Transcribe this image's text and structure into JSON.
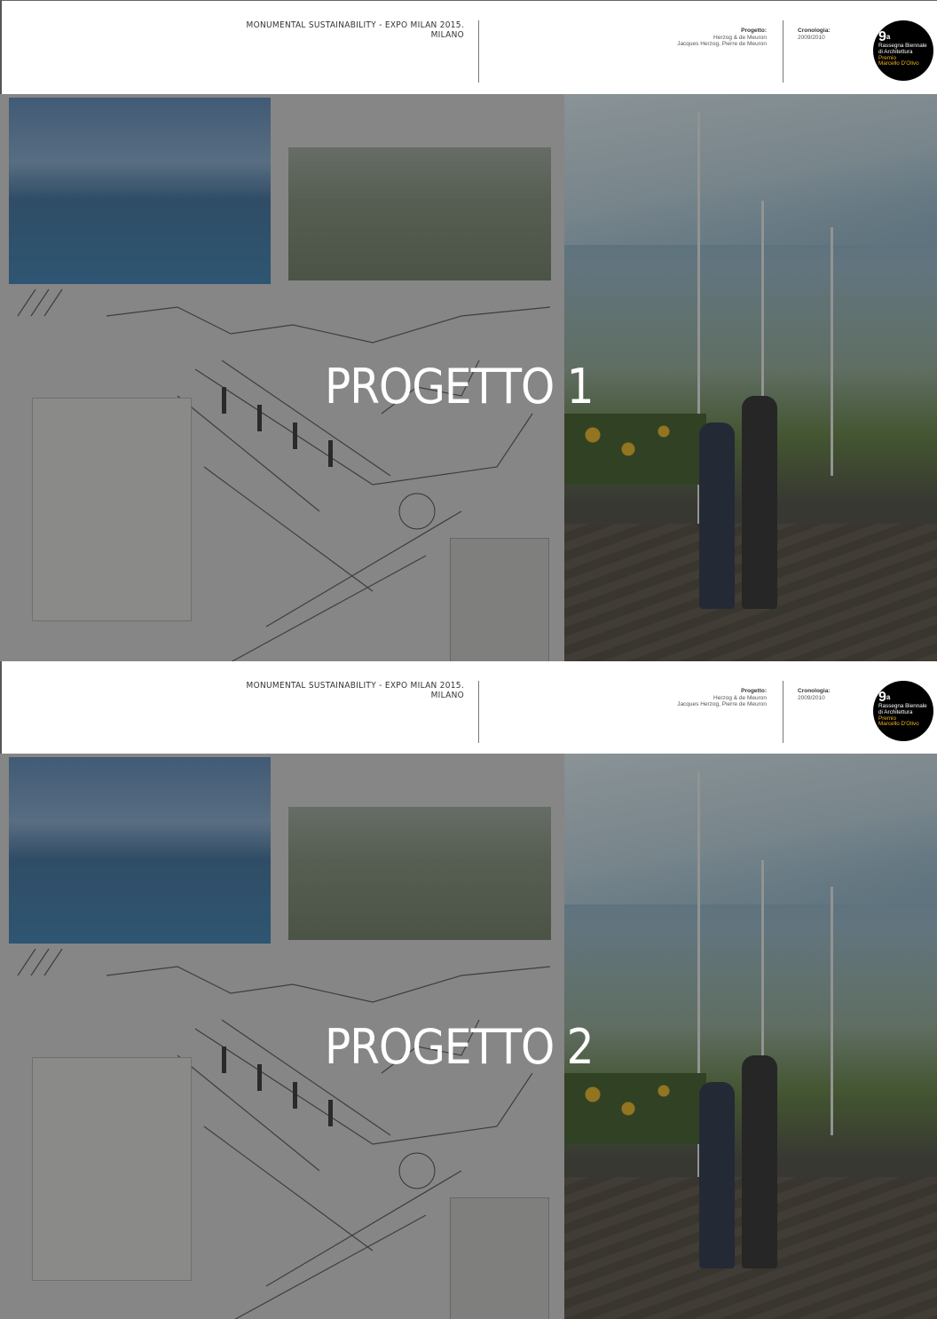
{
  "slides": [
    {
      "header": {
        "title_line1": "MONUMENTAL SUSTAINABILITY - EXPO MILAN 2015.",
        "title_line2": "MILANO",
        "project_label": "Progetto:",
        "project_line1": "Herzog & de Meuron",
        "project_line2": "Jacques Herzog, Pierre de Meuron",
        "chrono_label": "Cronologia:",
        "chrono_value": "2009/2010"
      },
      "badge": {
        "number": "9",
        "superscript": "a",
        "line1": "Rassegna Biennale",
        "line2": "di Architettura",
        "line3": "Premio",
        "line4": "Marcello D'Olivo"
      },
      "overlay_title": "PROGETTO 1"
    },
    {
      "header": {
        "title_line1": "MONUMENTAL SUSTAINABILITY - EXPO MILAN 2015.",
        "title_line2": "MILANO",
        "project_label": "Progetto:",
        "project_line1": "Herzog & de Meuron",
        "project_line2": "Jacques Herzog, Pierre de Meuron",
        "chrono_label": "Cronologia:",
        "chrono_value": "2009/2010"
      },
      "badge": {
        "number": "9",
        "superscript": "a",
        "line1": "Rassegna Biennale",
        "line2": "di Architettura",
        "line3": "Premio",
        "line4": "Marcello D'Olivo"
      },
      "overlay_title": "PROGETTO 2"
    }
  ],
  "colors": {
    "badge_background": "#000000",
    "badge_accent": "#f0b323",
    "overlay_text": "#ffffff"
  }
}
